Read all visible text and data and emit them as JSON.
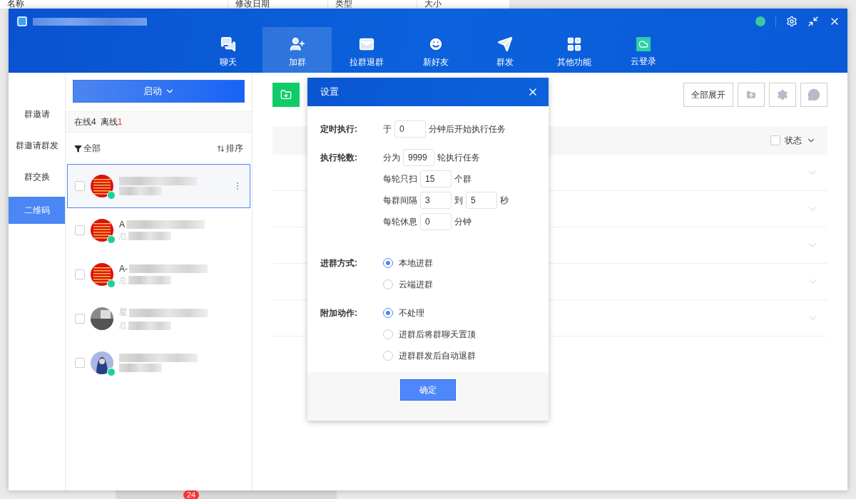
{
  "background": {
    "columns": [
      "名称",
      "修改日期",
      "类型",
      "大小"
    ],
    "badge": "24"
  },
  "toolbar": [
    {
      "label": "聊天",
      "kind": "chat",
      "selected": false
    },
    {
      "label": "加群",
      "kind": "add-user",
      "selected": true
    },
    {
      "label": "拉群退群",
      "kind": "mail",
      "selected": false
    },
    {
      "label": "新好友",
      "kind": "smile",
      "selected": false
    },
    {
      "label": "群发",
      "kind": "send",
      "selected": false
    },
    {
      "label": "其他功能",
      "kind": "grid",
      "selected": false
    },
    {
      "label": "云登录",
      "kind": "cloud",
      "selected": false
    }
  ],
  "sidebar": [
    {
      "label": "群邀请",
      "selected": false
    },
    {
      "label": "群邀请群发",
      "selected": false
    },
    {
      "label": "群交换",
      "selected": false
    },
    {
      "label": "二维码",
      "selected": true
    }
  ],
  "start_button": "启动",
  "status": {
    "online_label": "在线",
    "online": "4",
    "offline_label": "离线",
    "offline": "1"
  },
  "filter": "全部",
  "sort": "排序",
  "accounts": [
    {
      "selected": true,
      "checked": false,
      "online": true
    },
    {
      "name": "A",
      "sub": "总",
      "selected": false,
      "checked": false,
      "online": true
    },
    {
      "name": "A-",
      "sub": "总",
      "selected": false,
      "checked": false,
      "online": true
    },
    {
      "name": "星",
      "sub": "总",
      "selected": false,
      "checked": false,
      "online": false
    },
    {
      "selected": false,
      "checked": false,
      "online": true
    }
  ],
  "content": {
    "expand_all": "全部展开",
    "status_header": "状态",
    "all_checked": false,
    "rows": [
      {
        "expanded": false
      },
      {
        "expanded": false
      },
      {
        "expanded": false
      },
      {
        "expanded": false
      },
      {
        "expanded": false
      }
    ]
  },
  "dialog": {
    "title": "设置",
    "sections": [
      {
        "label": "定时执行:",
        "kind": "fields",
        "lines": [
          [
            {
              "kind": "text",
              "text": "于"
            },
            {
              "kind": "input",
              "value": "0"
            },
            {
              "kind": "text",
              "text": "分钟后开始执行任务"
            }
          ]
        ]
      },
      {
        "label": "执行轮数:",
        "kind": "fields",
        "lines": [
          [
            {
              "kind": "text",
              "text": "分为"
            },
            {
              "kind": "input",
              "value": "9999"
            },
            {
              "kind": "text",
              "text": "轮执行任务"
            }
          ],
          [
            {
              "kind": "text",
              "text": "每轮只扫"
            },
            {
              "kind": "input",
              "value": "15"
            },
            {
              "kind": "text",
              "text": "个群"
            }
          ],
          [
            {
              "kind": "text",
              "text": "每群间隔"
            },
            {
              "kind": "input",
              "value": "3"
            },
            {
              "kind": "text",
              "text": "到"
            },
            {
              "kind": "input",
              "value": "5"
            },
            {
              "kind": "text",
              "text": "秒"
            }
          ],
          [
            {
              "kind": "text",
              "text": "每轮休息"
            },
            {
              "kind": "input",
              "value": "0"
            },
            {
              "kind": "text",
              "text": "分钟"
            }
          ]
        ]
      },
      {
        "label": "进群方式:",
        "kind": "radios",
        "options": [
          {
            "label": "本地进群",
            "selected": true
          },
          {
            "label": "云端进群",
            "selected": false
          }
        ]
      },
      {
        "label": "附加动作:",
        "kind": "radios",
        "options": [
          {
            "label": "不处理",
            "selected": true
          },
          {
            "label": "进群后将群聊天置顶",
            "selected": false
          },
          {
            "label": "进群群发后自动退群",
            "selected": false
          }
        ]
      }
    ],
    "confirm": "确定"
  }
}
